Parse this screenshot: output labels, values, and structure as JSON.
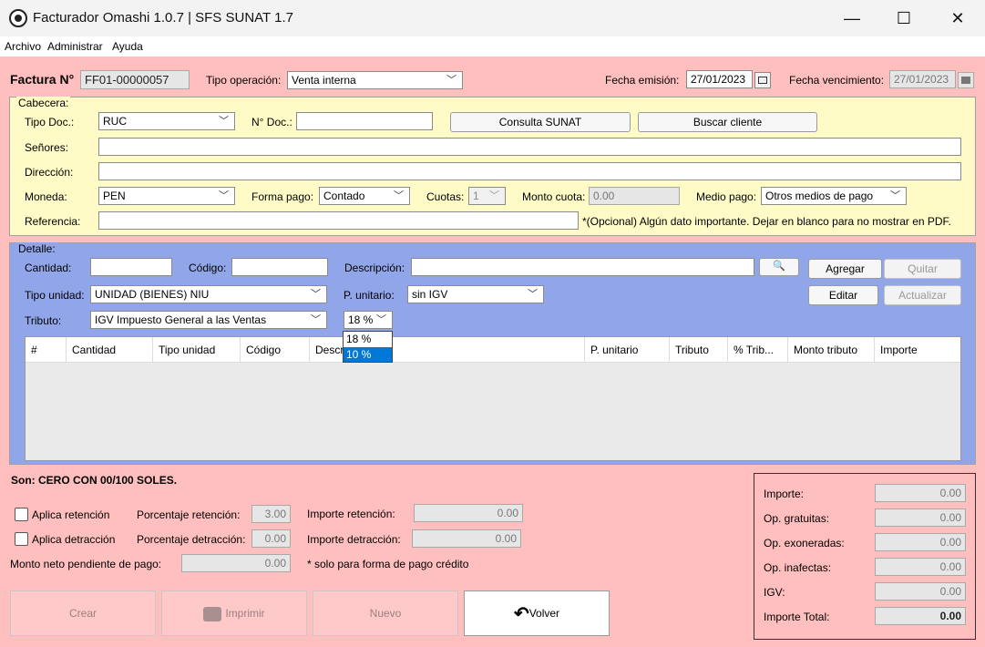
{
  "window": {
    "title": "Facturador Omashi 1.0.7 | SFS SUNAT 1.7",
    "minimize": "—",
    "maximize": "☐",
    "close": "✕"
  },
  "menu": [
    "Archivo",
    "Administrar",
    "Ayuda"
  ],
  "header": {
    "factura_label": "Factura N°",
    "factura_number": "FF01-00000057",
    "tipo_operacion_label": "Tipo operación:",
    "tipo_operacion_value": "Venta interna",
    "fecha_emision_label": "Fecha emisión:",
    "fecha_emision_value": "27/01/2023",
    "fecha_vencimiento_label": "Fecha vencimiento:",
    "fecha_vencimiento_value": "27/01/2023"
  },
  "cabecera": {
    "title": "Cabecera:",
    "tipo_doc_label": "Tipo Doc.:",
    "tipo_doc_value": "RUC",
    "num_doc_label": "N° Doc.:",
    "num_doc_value": "",
    "consulta_sunat": "Consulta SUNAT",
    "buscar_cliente": "Buscar cliente",
    "senores_label": "Señores:",
    "senores_value": "",
    "direccion_label": "Dirección:",
    "direccion_value": "",
    "moneda_label": "Moneda:",
    "moneda_value": "PEN",
    "forma_pago_label": "Forma pago:",
    "forma_pago_value": "Contado",
    "cuotas_label": "Cuotas:",
    "cuotas_value": "1",
    "monto_cuota_label": "Monto cuota:",
    "monto_cuota_value": "0.00",
    "medio_pago_label": "Medio pago:",
    "medio_pago_value": "Otros medios de pago",
    "referencia_label": "Referencia:",
    "referencia_value": "",
    "referencia_hint": "*(Opcional) Algún dato importante. Dejar en blanco para no mostrar en PDF."
  },
  "detalle": {
    "title": "Detalle:",
    "cantidad_label": "Cantidad:",
    "codigo_label": "Código:",
    "descripcion_label": "Descripción:",
    "agregar": "Agregar",
    "quitar": "Quitar",
    "tipo_unidad_label": "Tipo unidad:",
    "tipo_unidad_value": "UNIDAD (BIENES) NIU",
    "p_unitario_label": "P. unitario:",
    "p_unitario_value": "sin IGV",
    "editar": "Editar",
    "actualizar": "Actualizar",
    "tributo_label": "Tributo:",
    "tributo_value": "IGV Impuesto General a las Ventas",
    "igv_pct_value": "18 %",
    "igv_options": [
      "18 %",
      "10 %"
    ],
    "columns": [
      "#",
      "Cantidad",
      "Tipo unidad",
      "Código",
      "Descr",
      "P. unitario",
      "Tributo",
      "% Trib...",
      "Monto tributo",
      "Importe"
    ]
  },
  "son": "Son:  CERO CON 00/100 SOLES.",
  "retenciones": {
    "aplica_retencion": "Aplica retención",
    "porcentaje_retencion_label": "Porcentaje retención:",
    "porcentaje_retencion_value": "3.00",
    "importe_retencion_label": "Importe retención:",
    "importe_retencion_value": "0.00",
    "aplica_detraccion": "Aplica detracción",
    "porcentaje_detraccion_label": "Porcentaje detracción:",
    "porcentaje_detraccion_value": "0.00",
    "importe_detraccion_label": "Importe detracción:",
    "importe_detraccion_value": "0.00",
    "monto_neto_label": "Monto neto pendiente de pago:",
    "monto_neto_value": "0.00",
    "monto_neto_hint": "* solo para forma de pago crédito"
  },
  "totals": [
    {
      "label": "Importe:",
      "value": "0.00"
    },
    {
      "label": "Op. gratuitas:",
      "value": "0.00"
    },
    {
      "label": "Op. exoneradas:",
      "value": "0.00"
    },
    {
      "label": "Op. inafectas:",
      "value": "0.00"
    },
    {
      "label": "IGV:",
      "value": "0.00"
    },
    {
      "label": "Importe Total:",
      "value": "0.00"
    }
  ],
  "actions": {
    "crear": "Crear",
    "imprimir": "Imprimir",
    "nuevo": "Nuevo",
    "volver": "Volver"
  }
}
